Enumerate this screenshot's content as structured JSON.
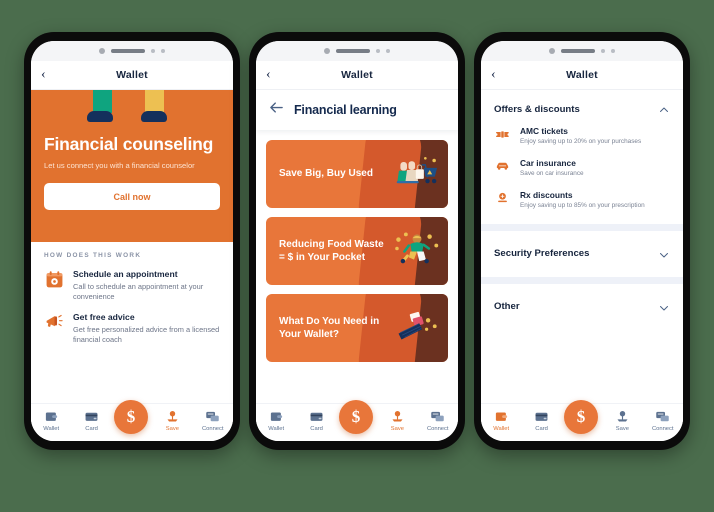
{
  "theme": {
    "background": "#4b6d4d",
    "orange": "#e1722f",
    "orange_card": "#e8763a",
    "navy": "#16243d",
    "muted": "#7b8394",
    "tab_inactive": "#5c718f"
  },
  "phones": [
    {
      "id": "phone-financial-counseling",
      "navbar": {
        "back_icon": "chevron-left-icon",
        "title": "Wallet"
      },
      "hero": {
        "title": "Financial counseling",
        "subtitle": "Let us connect you with a financial counselor",
        "cta_label": "Call now",
        "illustration": "two-legs-walking-illustration"
      },
      "how_it_works": {
        "label": "HOW DOES THIS WORK",
        "steps": [
          {
            "icon": "calendar-icon",
            "title": "Schedule an appointment",
            "desc": "Call to schedule an appointment at your convenience"
          },
          {
            "icon": "megaphone-icon",
            "title": "Get free advice",
            "desc": "Get free personalized advice from a licensed financial coach"
          }
        ]
      },
      "tabbar": {
        "active": "Save",
        "items": [
          {
            "icon": "wallet-icon",
            "label": "Wallet"
          },
          {
            "icon": "card-icon",
            "label": "Card"
          },
          {
            "icon": "dollar-icon",
            "label": "$",
            "fab": true
          },
          {
            "icon": "save-plant-icon",
            "label": "Save"
          },
          {
            "icon": "chat-icon",
            "label": "Connect"
          }
        ]
      }
    },
    {
      "id": "phone-financial-learning",
      "navbar": {
        "back_icon": "chevron-left-icon",
        "title": "Wallet"
      },
      "sub_header": {
        "back_icon": "arrow-left-icon",
        "title": "Financial learning"
      },
      "cards": [
        {
          "title": "Save Big, Buy Used",
          "art": "shopping-cart-illustration"
        },
        {
          "title": "Reducing Food Waste = $ in Your Pocket",
          "art": "running-person-coins-illustration"
        },
        {
          "title": "What Do You Need in Your Wallet?",
          "art": "wallet-cards-illustration"
        }
      ],
      "tabbar": {
        "active": "Save",
        "items": [
          {
            "icon": "wallet-icon",
            "label": "Wallet"
          },
          {
            "icon": "card-icon",
            "label": "Card"
          },
          {
            "icon": "dollar-icon",
            "label": "$",
            "fab": true
          },
          {
            "icon": "save-plant-icon",
            "label": "Save"
          },
          {
            "icon": "chat-icon",
            "label": "Connect"
          }
        ]
      }
    },
    {
      "id": "phone-offers-discounts",
      "navbar": {
        "back_icon": "chevron-left-icon",
        "title": "Wallet"
      },
      "sections": [
        {
          "title": "Offers & discounts",
          "chevron": "chevron-up-icon",
          "expanded": true,
          "offers": [
            {
              "icon": "ticket-icon",
              "title": "AMC tickets",
              "desc": "Enjoy saving up to 20% on your purchases"
            },
            {
              "icon": "car-icon",
              "title": "Car insurance",
              "desc": "Save on car insurance"
            },
            {
              "icon": "pill-icon",
              "title": "Rx discounts",
              "desc": "Enjoy saving up to 85% on your prescription"
            }
          ]
        },
        {
          "title": "Security Preferences",
          "chevron": "chevron-down-icon",
          "expanded": false,
          "offers": []
        },
        {
          "title": "Other",
          "chevron": "chevron-down-icon",
          "expanded": false,
          "offers": []
        }
      ],
      "tabbar": {
        "active": "Wallet",
        "items": [
          {
            "icon": "wallet-icon",
            "label": "Wallet"
          },
          {
            "icon": "card-icon",
            "label": "Card"
          },
          {
            "icon": "dollar-icon",
            "label": "$",
            "fab": true
          },
          {
            "icon": "save-plant-icon",
            "label": "Save"
          },
          {
            "icon": "chat-icon",
            "label": "Connect"
          }
        ]
      }
    }
  ]
}
